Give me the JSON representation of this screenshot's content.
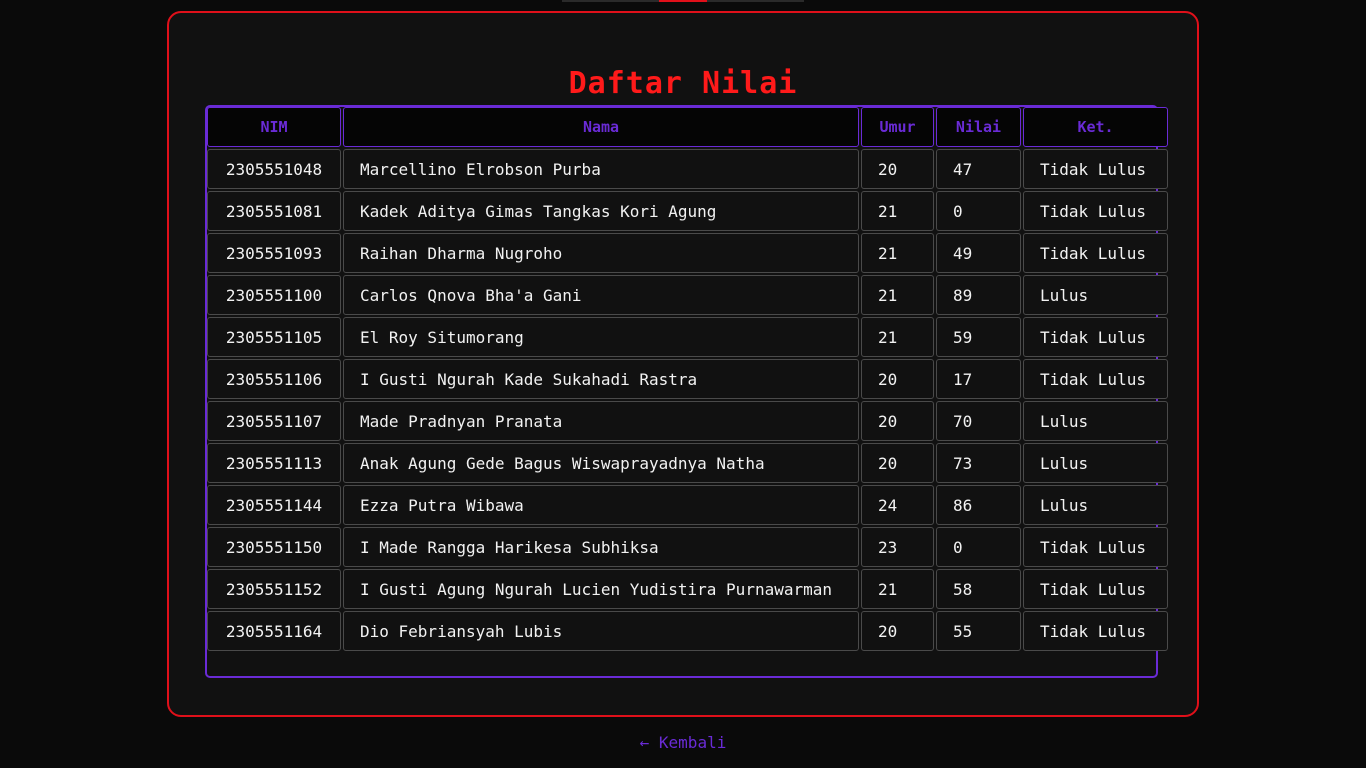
{
  "page": {
    "title": "Daftar Nilai",
    "back_link": "← Kembali"
  },
  "colors": {
    "accent_red": "#e0101a",
    "accent_purple": "#6a2bd6",
    "background": "#0a0a0a",
    "card_bg": "#111111",
    "text": "#f2f2f2"
  },
  "table": {
    "headers": [
      "NIM",
      "Nama",
      "Umur",
      "Nilai",
      "Ket."
    ],
    "rows": [
      [
        "2305551048",
        "Marcellino Elrobson Purba",
        "20",
        "47",
        "Tidak Lulus"
      ],
      [
        "2305551081",
        "Kadek Aditya Gimas Tangkas Kori Agung",
        "21",
        "0",
        "Tidak Lulus"
      ],
      [
        "2305551093",
        "Raihan Dharma Nugroho",
        "21",
        "49",
        "Tidak Lulus"
      ],
      [
        "2305551100",
        "Carlos Qnova Bha'a Gani",
        "21",
        "89",
        "Lulus"
      ],
      [
        "2305551105",
        "El Roy Situmorang",
        "21",
        "59",
        "Tidak Lulus"
      ],
      [
        "2305551106",
        "I Gusti Ngurah Kade Sukahadi Rastra",
        "20",
        "17",
        "Tidak Lulus"
      ],
      [
        "2305551107",
        "Made Pradnyan Pranata",
        "20",
        "70",
        "Lulus"
      ],
      [
        "2305551113",
        "Anak Agung Gede Bagus Wiswaprayadnya Natha",
        "20",
        "73",
        "Lulus"
      ],
      [
        "2305551144",
        "Ezza Putra Wibawa",
        "24",
        "86",
        "Lulus"
      ],
      [
        "2305551150",
        "I Made Rangga Harikesa Subhiksa",
        "23",
        "0",
        "Tidak Lulus"
      ],
      [
        "2305551152",
        "I Gusti Agung Ngurah Lucien Yudistira Purnawarman",
        "21",
        "58",
        "Tidak Lulus"
      ],
      [
        "2305551164",
        "Dio Febriansyah Lubis",
        "20",
        "55",
        "Tidak Lulus"
      ]
    ]
  }
}
